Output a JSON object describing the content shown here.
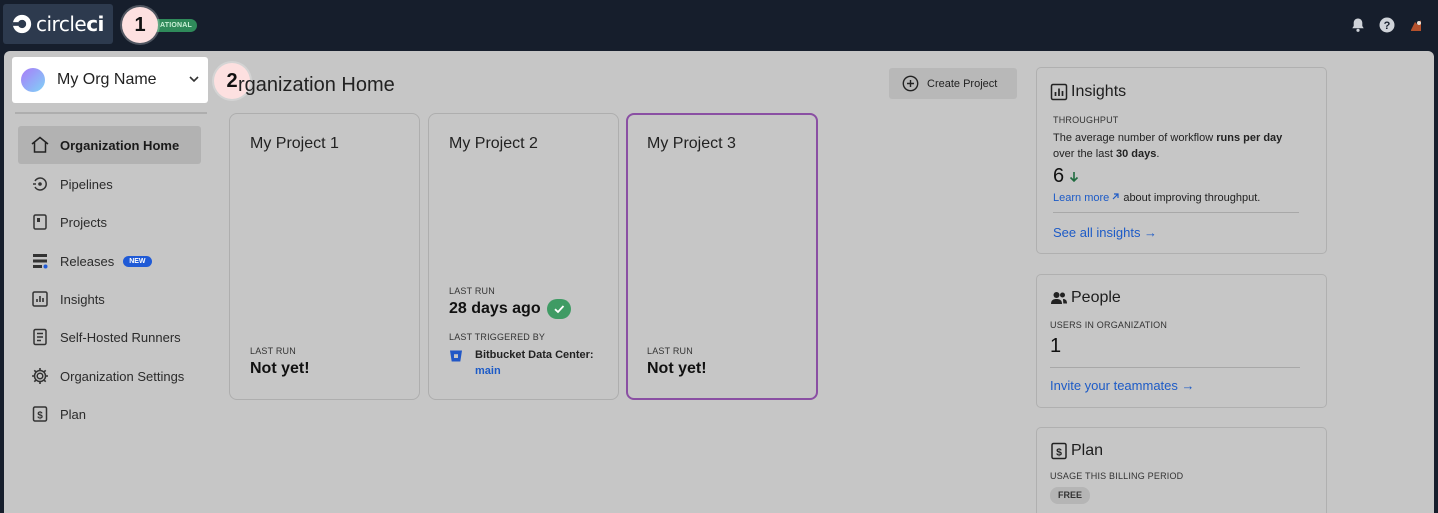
{
  "topbar": {
    "logo_text_light": "circle",
    "logo_text_bold": "ci",
    "status_badge": "ATIONAL",
    "icons": [
      "bell-icon",
      "help-icon",
      "user-avatar"
    ]
  },
  "steps": {
    "one": "1",
    "two": "2"
  },
  "org": {
    "name": "My Org Name"
  },
  "sidebar": {
    "items": [
      {
        "label": "Organization Home",
        "icon": "home-icon",
        "active": true
      },
      {
        "label": "Pipelines",
        "icon": "pipelines-icon"
      },
      {
        "label": "Projects",
        "icon": "projects-icon"
      },
      {
        "label": "Releases",
        "icon": "releases-icon",
        "badge": "NEW"
      },
      {
        "label": "Insights",
        "icon": "insights-icon"
      },
      {
        "label": "Self-Hosted Runners",
        "icon": "runners-icon"
      },
      {
        "label": "Organization Settings",
        "icon": "gear-icon"
      },
      {
        "label": "Plan",
        "icon": "plan-icon"
      }
    ]
  },
  "main": {
    "title": "rganization Home",
    "create_label": "Create Project",
    "projects": [
      {
        "name": "My Project 1",
        "last_run_label": "LAST RUN",
        "last_run": "Not yet!"
      },
      {
        "name": "My Project 2",
        "last_run_label": "LAST RUN",
        "last_run": "28 days ago",
        "triggered_label": "LAST TRIGGERED BY",
        "trigger_source": "Bitbucket Data Center:",
        "trigger_branch": "main"
      },
      {
        "name": "My Project 3",
        "last_run_label": "LAST RUN",
        "last_run": "Not yet!"
      }
    ]
  },
  "insights": {
    "title": "Insights",
    "label": "THROUGHPUT",
    "desc_1": "The average number of workflow ",
    "desc_bold_1": "runs per day",
    "desc_2": "over the last ",
    "desc_bold_2": "30 days",
    "desc_end": ".",
    "value": "6",
    "learn_more": "Learn more",
    "learn_more_suffix": " about improving throughput.",
    "see_all": "See all insights →"
  },
  "people": {
    "title": "People",
    "label": "USERS IN ORGANIZATION",
    "value": "1",
    "invite": "Invite your teammates →"
  },
  "plan": {
    "title": "Plan",
    "label": "USAGE THIS BILLING PERIOD",
    "tier": "FREE"
  },
  "colors": {
    "topbar_bg": "#161e2c",
    "overlay_panel": "#c6c6c6",
    "accent_link": "#1d5bc7",
    "success": "#3f9b64",
    "selected_border": "#8a4fa3"
  }
}
